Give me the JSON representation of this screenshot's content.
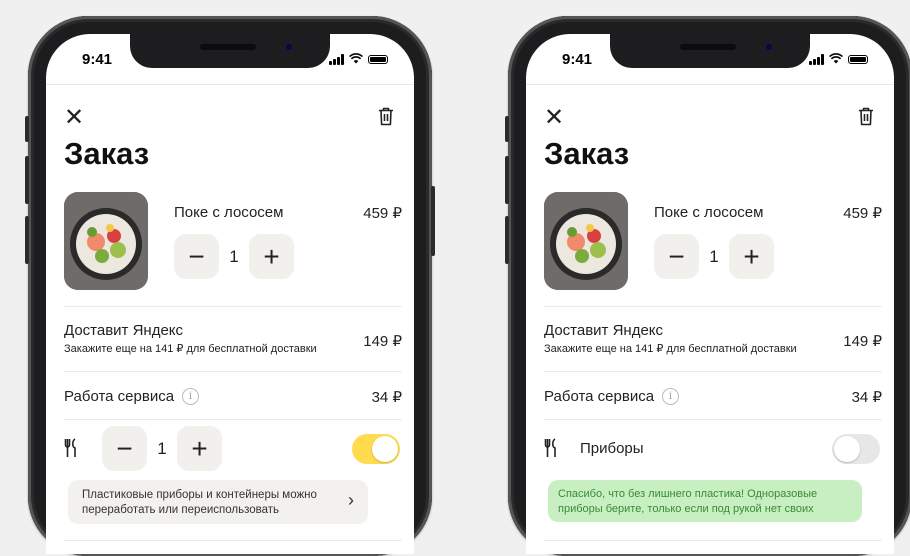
{
  "colors": {
    "accent": "#ffdb4d",
    "eco_bg": "#c8efc1",
    "eco_text": "#3a8a35"
  },
  "screens": [
    {
      "status_time": "9:41",
      "title": "Заказ",
      "item": {
        "name": "Поке с лососем",
        "price": "459 ₽",
        "qty": "1"
      },
      "delivery": {
        "title": "Доставит Яндекс",
        "subtitle": "Закажите еще на 141 ₽ для бесплатной доставки",
        "price": "149 ₽"
      },
      "service": {
        "title": "Работа сервиса",
        "price": "34 ₽"
      },
      "cutlery": {
        "qty": "1",
        "enabled": true
      },
      "hint": {
        "text_line1": "Пластиковые приборы и контейнеры можно",
        "text_line2": "переработать или переиспользовать"
      }
    },
    {
      "status_time": "9:41",
      "title": "Заказ",
      "item": {
        "name": "Поке с лососем",
        "price": "459 ₽",
        "qty": "1"
      },
      "delivery": {
        "title": "Доставит Яндекс",
        "subtitle": "Закажите еще на 141 ₽ для бесплатной доставки",
        "price": "149 ₽"
      },
      "service": {
        "title": "Работа сервиса",
        "price": "34 ₽"
      },
      "cutlery": {
        "label": "Приборы",
        "enabled": false
      },
      "eco_note": {
        "text_line1": "Спасибо, что без лишнего пластика! Одноразовые",
        "text_line2": "приборы берите, только если под рукой нет своих"
      }
    }
  ],
  "icons": {
    "close": "close-icon",
    "trash": "trash-icon",
    "info": "info-icon",
    "cutlery": "cutlery-icon",
    "chevron": "chevron-right-icon"
  }
}
